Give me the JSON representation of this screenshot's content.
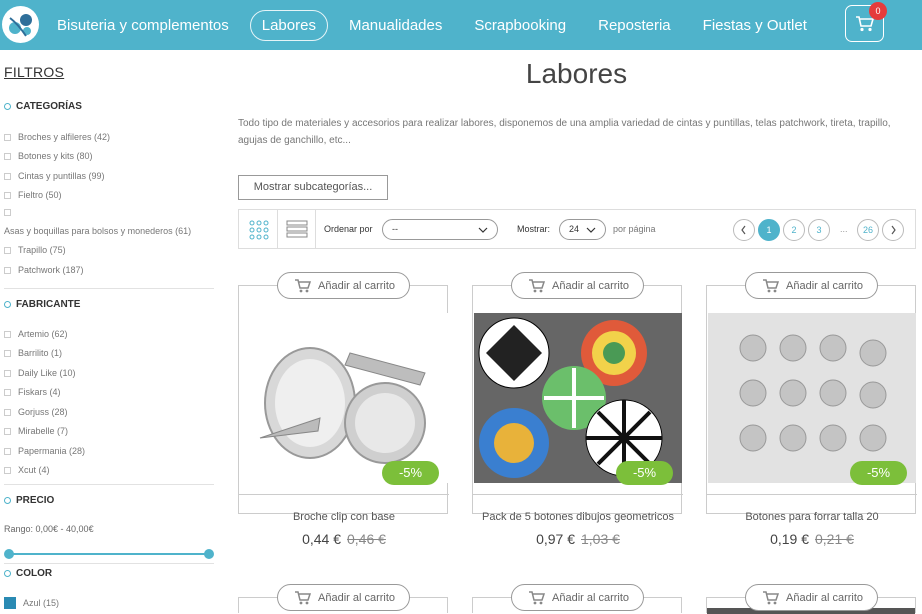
{
  "nav": {
    "items": [
      "Bisuteria y complementos",
      "Labores",
      "Manualidades",
      "Scrapbooking",
      "Reposteria",
      "Fiestas y Outlet"
    ],
    "active": "Labores",
    "cart_count": "0"
  },
  "sidebar": {
    "filtros": "FILTROS",
    "categorias": {
      "title": "CATEGORÍAS",
      "items": [
        "Broches y alfileres (42)",
        "Botones y kits (80)",
        "Cintas y puntillas (99)",
        "Fieltro (50)",
        "",
        "Asas y boquillas para bolsos y monederos (61)",
        "Trapillo (75)",
        "Patchwork (187)"
      ]
    },
    "fabricante": {
      "title": "FABRICANTE",
      "items": [
        "Artemio (62)",
        "Barrilito (1)",
        "Daily Like (10)",
        "Fiskars (4)",
        "Gorjuss (28)",
        "Mirabelle (7)",
        "Papermania (28)",
        "Xcut (4)"
      ]
    },
    "precio": {
      "title": "PRECIO",
      "range": "Rango: 0,00€ - 40,00€"
    },
    "color": {
      "title": "COLOR",
      "items": [
        "Azul (15)"
      ],
      "swatch": "#2a8ab3"
    }
  },
  "main": {
    "title": "Labores",
    "description": "Todo tipo de materiales y accesorios para realizar labores, disponemos de una amplia variedad de cintas y puntillas, telas patchwork, tireta, trapillo, agujas de ganchillo, etc...",
    "subcat_button": "Mostrar subcategorías...",
    "toolbar": {
      "order_label": "Ordenar por",
      "order_value": "--",
      "show_label": "Mostrar:",
      "show_value": "24",
      "per_page": "por página",
      "pages": [
        "1",
        "2",
        "3",
        "26"
      ],
      "dots": "..."
    },
    "add_to_cart": "Añadir al carrito",
    "products": [
      {
        "name": "Broche clip con base",
        "price": "0,44 €",
        "old_price": "0,46 €",
        "discount": "-5%"
      },
      {
        "name": "Pack de 5 botones dibujos geometricos",
        "price": "0,97 €",
        "old_price": "1,03 €",
        "discount": "-5%"
      },
      {
        "name": "Botones para forrar talla 20",
        "price": "0,19 €",
        "old_price": "0,21 €",
        "discount": "-5%"
      }
    ],
    "accent": "#4fb3cb",
    "discount_color": "#7cbf3a"
  }
}
